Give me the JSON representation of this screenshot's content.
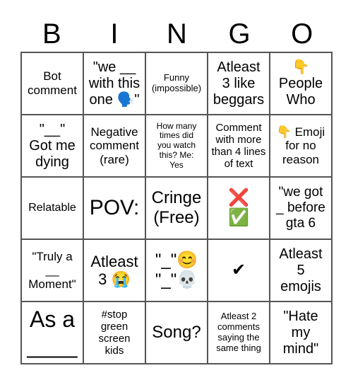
{
  "header": {
    "letters": [
      "B",
      "I",
      "N",
      "G",
      "O"
    ]
  },
  "cells": [
    "Bot\ncomment",
    "\"we __\nwith this\none 🗣️\"",
    "Funny\n(impossible)",
    "Atleast\n3 like\nbeggars",
    "👇\nPeople\nWho",
    "\"__\"\nGot me\ndying",
    "Negative\ncomment\n(rare)",
    "How many\ntimes did\nyou watch\nthis? Me:\nYes",
    "Comment\nwith more\nthan 4 lines\nof text",
    "👇 Emoji\nfor no\nreason",
    "Relatable",
    "POV:",
    "Cringe\n(Free)",
    "❌\n✅",
    "\"we got\n_ before\ngta 6",
    "\"Truly a\n__\nMoment\"",
    "Atleast\n3 😭",
    "\"_\"😊\n\"_\"💀",
    "✔",
    "Atleast\n5\nemojis",
    "As a\n____",
    "#stop\ngreen\nscreen\nkids",
    "Song?",
    "Atleast 2\ncomments\nsaying the\nsame thing",
    "\"Hate\nmy\nmind\""
  ]
}
